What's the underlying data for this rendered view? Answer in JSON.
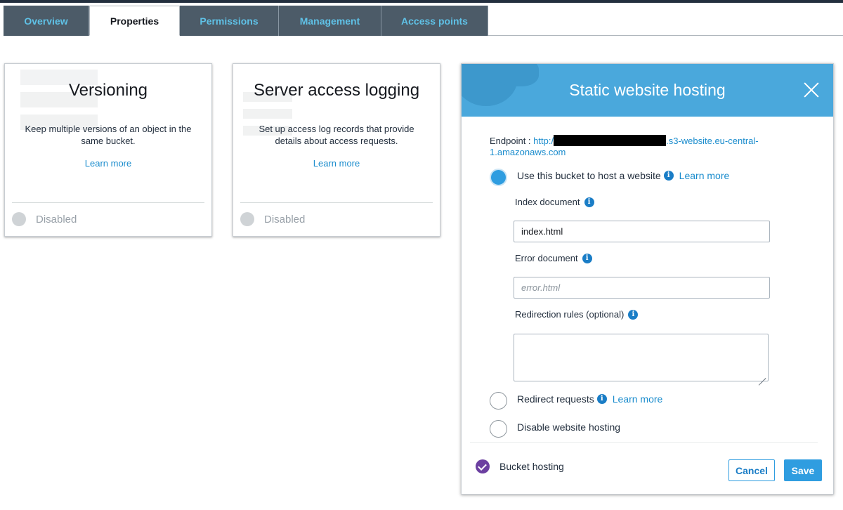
{
  "tabs": [
    {
      "label": "Overview",
      "active": false
    },
    {
      "label": "Properties",
      "active": true
    },
    {
      "label": "Permissions",
      "active": false
    },
    {
      "label": "Management",
      "active": false
    },
    {
      "label": "Access points",
      "active": false
    }
  ],
  "cards": {
    "versioning": {
      "title": "Versioning",
      "description": "Keep multiple versions of an object in the same bucket.",
      "learn_more": "Learn more",
      "status": "Disabled"
    },
    "logging": {
      "title": "Server access logging",
      "description": "Set up access log records that provide details about access requests.",
      "learn_more": "Learn more",
      "status": "Disabled"
    }
  },
  "panel": {
    "title": "Static website hosting",
    "endpoint_label": "Endpoint :",
    "endpoint_prefix": "http:/",
    "endpoint_suffix": ".s3-website.eu-central-1.amazonaws.com",
    "options": {
      "host": {
        "label": "Use this bucket to host a website",
        "learn_more": "Learn more",
        "selected": true
      },
      "redirect": {
        "label": "Redirect requests",
        "learn_more": "Learn more",
        "selected": false
      },
      "disable": {
        "label": "Disable website hosting",
        "selected": false
      }
    },
    "index_document": {
      "label": "Index document",
      "value": "index.html"
    },
    "error_document": {
      "label": "Error document",
      "placeholder": "error.html"
    },
    "redirection_rules": {
      "label": "Redirection rules (optional)",
      "value": ""
    },
    "footer": {
      "checkbox_label": "Bucket hosting",
      "cancel": "Cancel",
      "save": "Save"
    }
  },
  "colors": {
    "tab_bg": "#4c5b68",
    "tab_text": "#5fc1e6",
    "header_blue": "#4aa8dc",
    "link": "#1a8ccd",
    "button_blue": "#2f9de0",
    "check_purple": "#6b3fa0"
  },
  "icons": [
    "info-icon",
    "close-icon",
    "check-icon"
  ]
}
